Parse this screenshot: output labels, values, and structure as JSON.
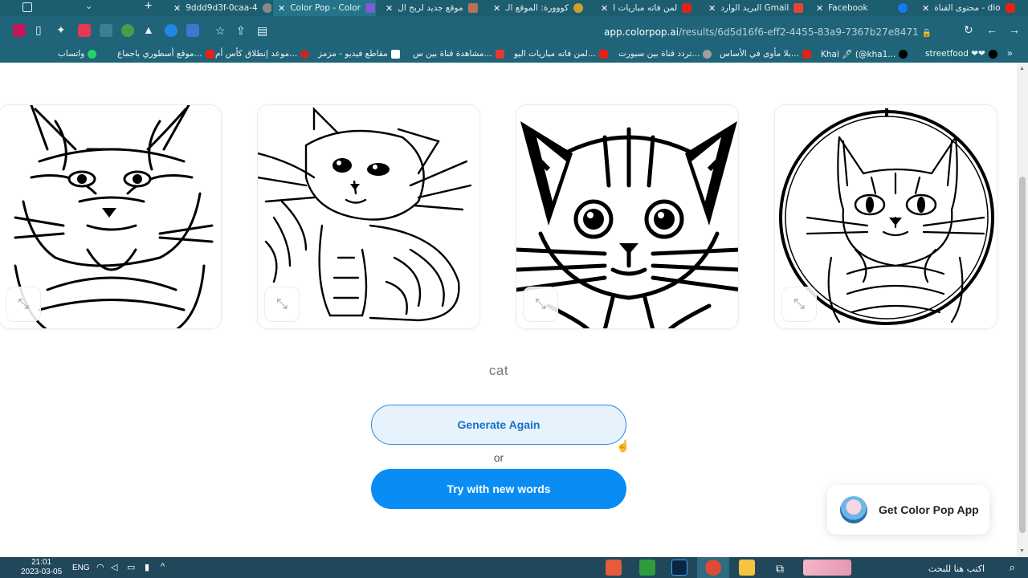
{
  "browser": {
    "tabs": [
      {
        "title": "9ddd9d3f-0caa-4",
        "color": "#888888"
      },
      {
        "title": "Color Pop - Color",
        "color": "#7a5cd6",
        "active": true
      },
      {
        "title": "موقع جديد لربح ال",
        "color": "#b5735a"
      },
      {
        "title": "كووورة: الموقع الـ",
        "color": "#c9a227"
      },
      {
        "title": "لمن فاته مباريات ا",
        "color": "#e62117"
      },
      {
        "title": "البريد الوارد Gmail",
        "color": "#ea4335"
      },
      {
        "title": "Facebook",
        "color": "#1877f2"
      },
      {
        "title": "محتوى القناة - dio",
        "color": "#e62117"
      }
    ],
    "url_host": "app.colorpop.ai",
    "url_path": "/results/6d5d16f6-eff2-4455-83a9-7367b27e8471",
    "bookmarks": [
      {
        "label": "واتساب",
        "color": "#25d366"
      },
      {
        "label": "موقع أسطوري باجماع...",
        "color": "#e62117"
      },
      {
        "label": "موعد إنطلاق كأس أم...",
        "color": "#c62828"
      },
      {
        "label": "مقاطع فيديو - مزمز",
        "color": "#ffffff"
      },
      {
        "label": "مشاهدة قناة بين س...",
        "color": "#e53935"
      },
      {
        "label": "لمن فاته مباريات اليو...",
        "color": "#e62117"
      },
      {
        "label": "تردد قناة بين سبورت...",
        "color": "#9e9e9e"
      },
      {
        "label": "بلا مأوى في الأساس...",
        "color": "#e62117"
      },
      {
        "label": "Khal 🖊 (@kha1...",
        "color": "#000000"
      },
      {
        "label": "streetfood ❤❤",
        "color": "#000000"
      }
    ]
  },
  "page": {
    "prompt": "cat",
    "generate_again": "Generate Again",
    "or": "or",
    "try_new": "Try with new words",
    "promo": "Get Color Pop App",
    "images": [
      {
        "alt": "striped cat coloring page"
      },
      {
        "alt": "fluffy kitten coloring page"
      },
      {
        "alt": "bold cat face coloring page"
      },
      {
        "alt": "cat in circle frame coloring page"
      }
    ],
    "expand_glyph": "⤡"
  },
  "taskbar": {
    "time": "21:01",
    "date": "2023-03-05",
    "lang": "ENG",
    "search": "اكتب هنا للبحث"
  }
}
